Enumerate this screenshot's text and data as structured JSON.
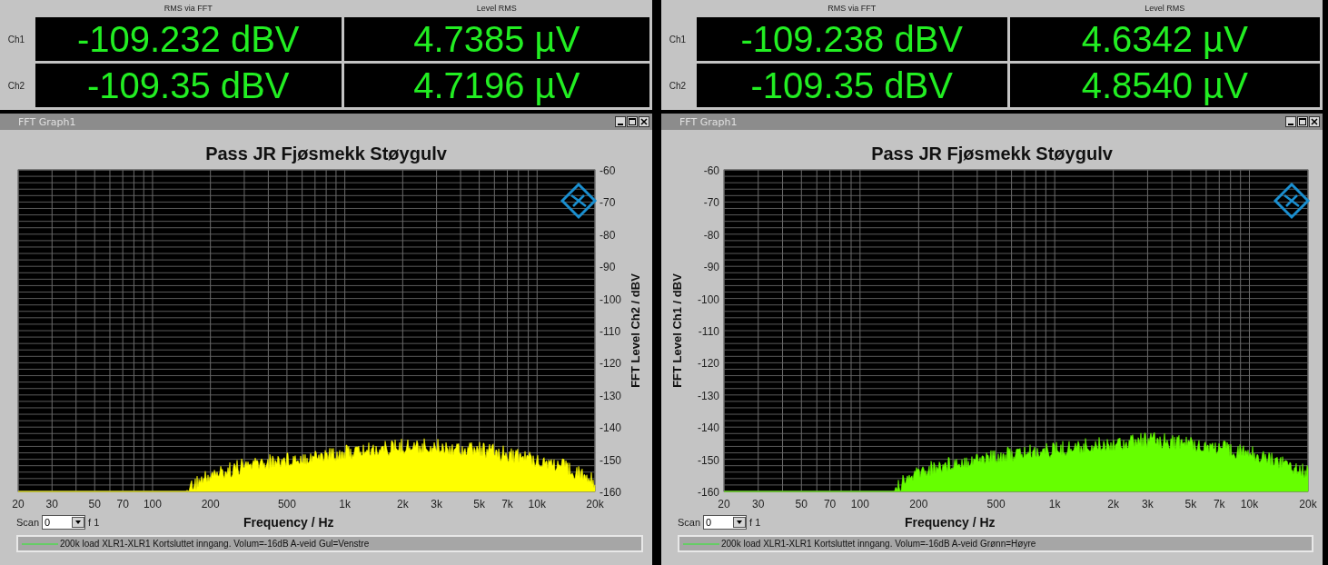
{
  "panels": [
    {
      "meter": {
        "columns": [
          "RMS via FFT",
          "Level RMS"
        ],
        "rows": [
          {
            "channel": "Ch1",
            "values": [
              "-109.232 dBV",
              "4.7385 µV"
            ]
          },
          {
            "channel": "Ch2",
            "values": [
              "-109.35 dBV",
              "4.7196 µV"
            ]
          }
        ]
      },
      "graph": {
        "title": "FFT Graph1",
        "plot": {
          "title": "Pass JR Fjøsmekk Støygulv",
          "xlabel": "Frequency / Hz",
          "ylabel": "FFT Level Ch2 / dBV",
          "color": "#ffff00",
          "x_tick_labels": [
            "20",
            "30",
            "50",
            "70",
            "100",
            "200",
            "500",
            "1k",
            "2k",
            "3k",
            "5k",
            "7k",
            "10k",
            "20k"
          ],
          "y_tick_labels": [
            "-60",
            "-70",
            "-80",
            "-90",
            "-100",
            "-110",
            "-120",
            "-130",
            "-140",
            "-150",
            "-160"
          ]
        },
        "scan": {
          "label": "Scan",
          "value": "0",
          "suffix": "f 1"
        },
        "legend": "200k load XLR1-XLR1 Kortsluttet inngang. Volum=-16dB A-veid Gul=Venstre"
      }
    },
    {
      "meter": {
        "columns": [
          "RMS via FFT",
          "Level RMS"
        ],
        "rows": [
          {
            "channel": "Ch1",
            "values": [
              "-109.238 dBV",
              "4.6342 µV"
            ]
          },
          {
            "channel": "Ch2",
            "values": [
              "-109.35 dBV",
              "4.8540 µV"
            ]
          }
        ]
      },
      "graph": {
        "title": "FFT Graph1",
        "plot": {
          "title": "Pass JR Fjøsmekk Støygulv",
          "xlabel": "Frequency / Hz",
          "ylabel": "FFT Level Ch1 / dBV",
          "color": "#66ff00",
          "x_tick_labels": [
            "20",
            "30",
            "50",
            "70",
            "100",
            "200",
            "500",
            "1k",
            "2k",
            "3k",
            "5k",
            "7k",
            "10k",
            "20k"
          ],
          "y_tick_labels": [
            "-60",
            "-70",
            "-80",
            "-90",
            "-100",
            "-110",
            "-120",
            "-130",
            "-140",
            "-150",
            "-160"
          ]
        },
        "scan": {
          "label": "Scan",
          "value": "0",
          "suffix": "f 1"
        },
        "legend": "200k load XLR1-XLR1 Kortsluttet inngang. Volum=-16dB A-veid Grønn=Høyre"
      }
    }
  ]
}
